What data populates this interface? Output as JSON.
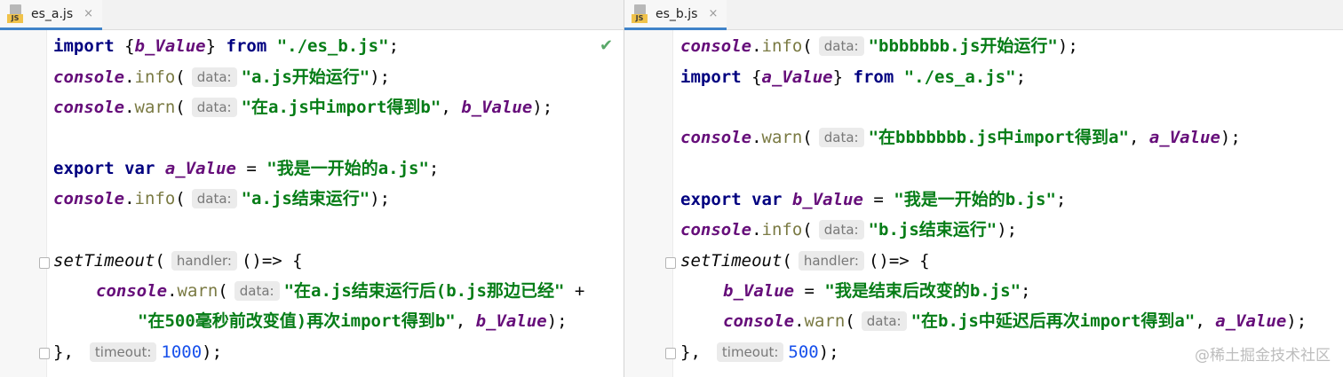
{
  "left": {
    "tab_label": "es_a.js",
    "icon_badge": "JS",
    "close_glyph": "×",
    "lines": {
      "l1": {
        "kw": "import",
        "open": " {",
        "var": "b_Value",
        "close": "} ",
        "kw2": "from",
        "sp": " ",
        "str": "\"./es_b.js\"",
        "end": ";"
      },
      "l2": {
        "obj": "console",
        "dot": ".",
        "fn": "info",
        "paren": "(",
        "hint": "data:",
        "str": "\"a.js开始运行\"",
        "end": ");"
      },
      "l3": {
        "obj": "console",
        "dot": ".",
        "fn": "warn",
        "paren": "(",
        "hint": "data:",
        "str": "\"在a.js中import得到b\"",
        "comma": ", ",
        "var": "b_Value",
        "end": ");"
      },
      "l5": {
        "kw": "export var",
        "sp": " ",
        "var": "a_Value",
        "eq": " = ",
        "str": "\"我是一开始的a.js\"",
        "end": ";"
      },
      "l6": {
        "obj": "console",
        "dot": ".",
        "fn": "info",
        "paren": "(",
        "hint": "data:",
        "str": "\"a.js结束运行\"",
        "end": ");"
      },
      "l8": {
        "fn": "setTimeout",
        "paren": "(",
        "hint": "handler:",
        "arrow": "()=> {"
      },
      "l9": {
        "obj": "console",
        "dot": ".",
        "fn": "warn",
        "paren": "(",
        "hint": "data:",
        "str": "\"在a.js结束运行后(b.js那边已经\"",
        "plus": " +"
      },
      "l10": {
        "str": "\"在500毫秒前改变值)再次import得到b\"",
        "comma": ", ",
        "var": "b_Value",
        "end": ");"
      },
      "l11": {
        "close": "},",
        "hint": "timeout:",
        "num": "1000",
        "end": ");"
      }
    }
  },
  "right": {
    "tab_label": "es_b.js",
    "icon_badge": "JS",
    "close_glyph": "×",
    "lines": {
      "l1": {
        "obj": "console",
        "dot": ".",
        "fn": "info",
        "paren": "(",
        "hint": "data:",
        "str": "\"bbbbbbb.js开始运行\"",
        "end": ");"
      },
      "l2": {
        "kw": "import",
        "open": " {",
        "var": "a_Value",
        "close": "} ",
        "kw2": "from",
        "sp": " ",
        "str": "\"./es_a.js\"",
        "end": ";"
      },
      "l4": {
        "obj": "console",
        "dot": ".",
        "fn": "warn",
        "paren": "(",
        "hint": "data:",
        "str": "\"在bbbbbbb.js中import得到a\"",
        "comma": ", ",
        "var": "a_Value",
        "end": ");"
      },
      "l6": {
        "kw": "export var",
        "sp": " ",
        "var": "b_Value",
        "eq": " = ",
        "str": "\"我是一开始的b.js\"",
        "end": ";"
      },
      "l7": {
        "obj": "console",
        "dot": ".",
        "fn": "info",
        "paren": "(",
        "hint": "data:",
        "str": "\"b.js结束运行\"",
        "end": ");"
      },
      "l8": {
        "fn": "setTimeout",
        "paren": "(",
        "hint": "handler:",
        "arrow": "()=> {"
      },
      "l9": {
        "var": "b_Value",
        "eq": " = ",
        "str": "\"我是结束后改变的b.js\"",
        "end": ";"
      },
      "l10": {
        "obj": "console",
        "dot": ".",
        "fn": "warn",
        "paren": "(",
        "hint": "data:",
        "str": "\"在b.js中延迟后再次import得到a\"",
        "comma": ", ",
        "var": "a_Value",
        "end": ");"
      },
      "l11": {
        "close": "},",
        "hint": "timeout:",
        "num": "500",
        "end": ");"
      }
    }
  },
  "status": {
    "check_glyph": "✔"
  },
  "watermark": "@稀土掘金技术社区",
  "colors": {
    "keyword": "#000080",
    "object": "#660e7a",
    "string": "#067d17",
    "number": "#1750eb",
    "tab_accent": "#4083c9",
    "check": "#59a869"
  }
}
